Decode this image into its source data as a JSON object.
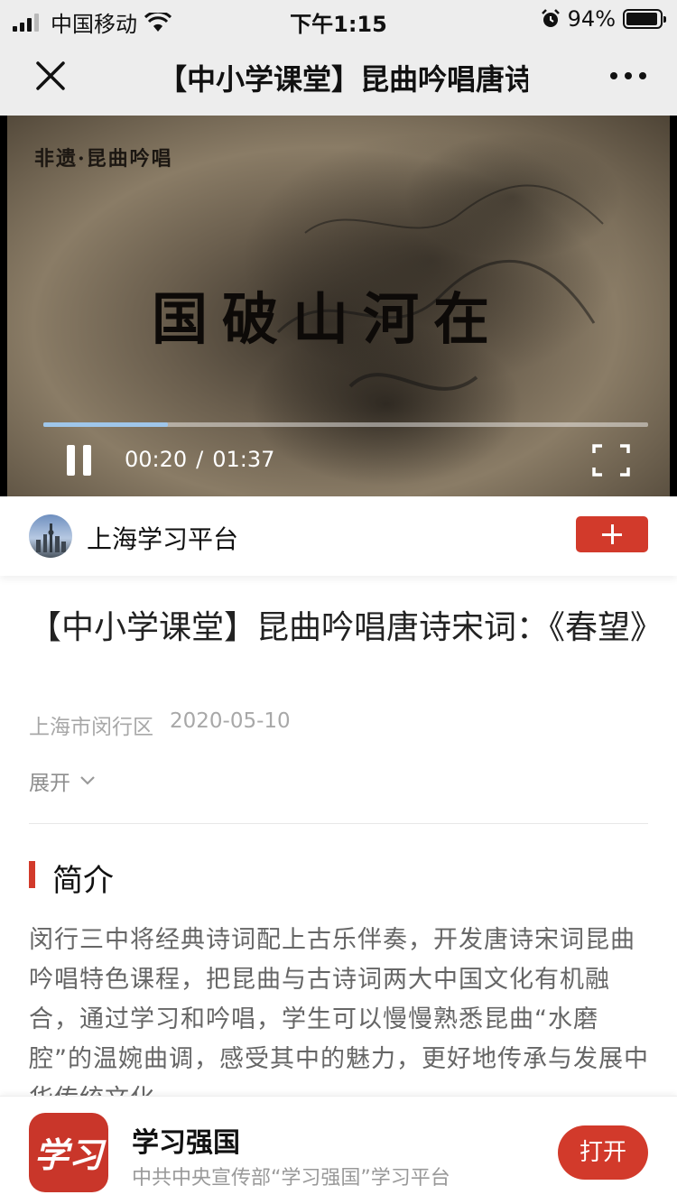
{
  "status_bar": {
    "carrier": "中国移动",
    "time": "下午1:15",
    "battery_percent": "94%",
    "battery_level": 0.94,
    "signal_icon": "signal-icon",
    "wifi_icon": "wifi-icon",
    "alarm_icon": "alarm-icon"
  },
  "nav": {
    "title": "【中小学课堂】昆曲吟唱唐诗宋词：《春望》",
    "close_icon": "close-icon",
    "more_icon": "more-icon"
  },
  "video": {
    "watermark": "非遗·昆曲吟唱",
    "overlay_text": "国破山河在",
    "current_time": "00:20",
    "separator": "/",
    "duration": "01:37",
    "progress_fraction": 0.206,
    "progress_color": "#9fc6ea"
  },
  "author": {
    "name": "上海学习平台",
    "follow_icon": "plus-icon"
  },
  "article": {
    "title": "【中小学课堂】昆曲吟唱唐诗宋词：《春望》",
    "location": "上海市闵行区",
    "date": "2020-05-10",
    "expand_label": "展开",
    "section_title": "简介",
    "intro": "闵行三中将经典诗词配上古乐伴奏，开发唐诗宋词昆曲吟唱特色课程，把昆曲与古诗词两大中国文化有机融合，通过学习和吟唱，学生可以慢慢熟悉昆曲“水磨腔”的温婉曲调，感受其中的魅力，更好地传承与发展中华传统文化。"
  },
  "banner": {
    "app_logo_text": "学习",
    "app_name": "学习强国",
    "app_desc": "中共中央宣传部“学习强国”学习平台",
    "open_label": "打开"
  },
  "colors": {
    "accent": "#d23a2b",
    "nav_bg": "#ededed"
  }
}
